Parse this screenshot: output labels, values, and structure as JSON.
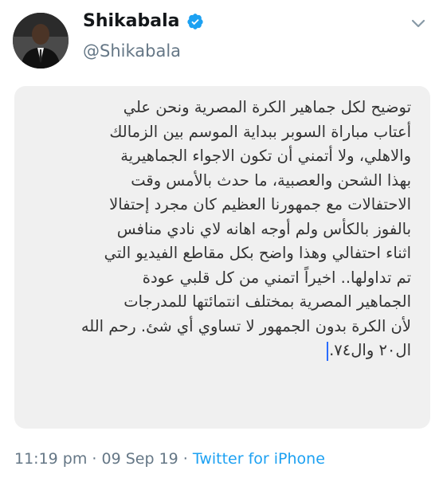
{
  "tweet": {
    "display_name": "Shikabala",
    "handle": "@Shikabala",
    "verified": true,
    "icons": {
      "verified": "verified-badge-icon",
      "menu": "chevron-down-icon"
    },
    "accent_color": "#1da1f2",
    "note_lines": [
      "توضيح لكل جماهير الكرة المصرية ونحن علي",
      "أعتاب مباراة السوبر ببداية الموسم بين الزمالك",
      "والاهلي، ولا أتمني أن تكون الاجواء الجماهيرية",
      "بهذا الشحن والعصبية، ما حدث بالأمس وقت",
      "الاحتفالات مع جمهورنا العظيم كان مجرد إحتفالا",
      "بالفوز بالكأس ولم أوجه اهانه لاي نادي منافس",
      "اثناء احتفالي وهذا واضح بكل مقاطع الفيديو التي",
      "تم تداولها.. اخيراً اتمني من كل قلبي عودة",
      "الجماهير المصرية بمختلف انتمائتها للمدرجات",
      "لأن الكرة بدون الجمهور لا تساوي أي شئ. رحم الله",
      "ال٢٠ وال٧٤."
    ],
    "time": "11:19 pm",
    "separator": " · ",
    "date": "09 Sep 19",
    "source": "Twitter for iPhone"
  }
}
